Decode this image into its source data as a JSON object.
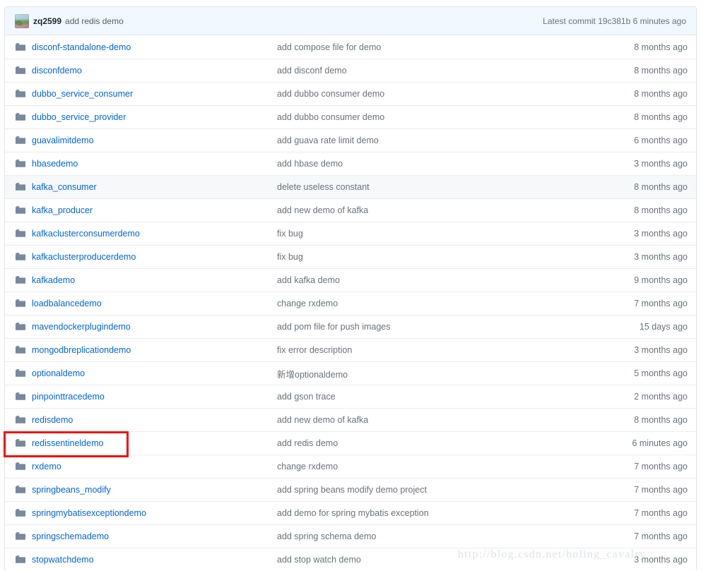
{
  "colors": {
    "link": "#0366d6",
    "muted": "#6a737d",
    "header_bg": "#f1f8ff",
    "border": "#dfe4e8",
    "row_border": "#eaecef",
    "row_hover": "#f6f8fa",
    "annotation": "#ee1111",
    "folder_icon": "#79889c"
  },
  "commit_header": {
    "avatar": "user-avatar",
    "author": "zq2599",
    "message": "add redis demo",
    "latest_commit_label": "Latest commit",
    "sha": "19c381b",
    "age": "6 minutes ago"
  },
  "files": [
    {
      "icon": "folder-icon",
      "name": "disconf-standalone-demo",
      "message": "add compose file for demo",
      "age": "8 months ago",
      "hovered": false,
      "highlighted": false
    },
    {
      "icon": "folder-icon",
      "name": "disconfdemo",
      "message": "add disconf demo",
      "age": "8 months ago",
      "hovered": false,
      "highlighted": false
    },
    {
      "icon": "folder-icon",
      "name": "dubbo_service_consumer",
      "message": "add dubbo consumer demo",
      "age": "8 months ago",
      "hovered": false,
      "highlighted": false
    },
    {
      "icon": "folder-icon",
      "name": "dubbo_service_provider",
      "message": "add dubbo consumer demo",
      "age": "8 months ago",
      "hovered": false,
      "highlighted": false
    },
    {
      "icon": "folder-icon",
      "name": "guavalimitdemo",
      "message": "add guava rate limit demo",
      "age": "6 months ago",
      "hovered": false,
      "highlighted": false
    },
    {
      "icon": "folder-icon",
      "name": "hbasedemo",
      "message": "add hbase demo",
      "age": "3 months ago",
      "hovered": false,
      "highlighted": false
    },
    {
      "icon": "folder-icon",
      "name": "kafka_consumer",
      "message": "delete useless constant",
      "age": "8 months ago",
      "hovered": true,
      "highlighted": false
    },
    {
      "icon": "folder-icon",
      "name": "kafka_producer",
      "message": "add new demo of kafka",
      "age": "8 months ago",
      "hovered": false,
      "highlighted": false
    },
    {
      "icon": "folder-icon",
      "name": "kafkaclusterconsumerdemo",
      "message": "fix bug",
      "age": "3 months ago",
      "hovered": false,
      "highlighted": false
    },
    {
      "icon": "folder-icon",
      "name": "kafkaclusterproducerdemo",
      "message": "fix bug",
      "age": "3 months ago",
      "hovered": false,
      "highlighted": false
    },
    {
      "icon": "folder-icon",
      "name": "kafkademo",
      "message": "add kafka demo",
      "age": "9 months ago",
      "hovered": false,
      "highlighted": false
    },
    {
      "icon": "folder-icon",
      "name": "loadbalancedemo",
      "message": "change rxdemo",
      "age": "7 months ago",
      "hovered": false,
      "highlighted": false
    },
    {
      "icon": "folder-icon",
      "name": "mavendockerplugindemo",
      "message": "add pom file for push images",
      "age": "15 days ago",
      "hovered": false,
      "highlighted": false
    },
    {
      "icon": "folder-icon",
      "name": "mongodbreplicationdemo",
      "message": "fix error description",
      "age": "3 months ago",
      "hovered": false,
      "highlighted": false
    },
    {
      "icon": "folder-icon",
      "name": "optionaldemo",
      "message": "新增optionaldemo",
      "age": "5 months ago",
      "hovered": false,
      "highlighted": false
    },
    {
      "icon": "folder-icon",
      "name": "pinpointtracedemo",
      "message": "add gson trace",
      "age": "2 months ago",
      "hovered": false,
      "highlighted": false
    },
    {
      "icon": "folder-icon",
      "name": "redisdemo",
      "message": "add new demo of kafka",
      "age": "8 months ago",
      "hovered": false,
      "highlighted": false
    },
    {
      "icon": "folder-icon",
      "name": "redissentineldemo",
      "message": "add redis demo",
      "age": "6 minutes ago",
      "hovered": false,
      "highlighted": true
    },
    {
      "icon": "folder-icon",
      "name": "rxdemo",
      "message": "change rxdemo",
      "age": "7 months ago",
      "hovered": false,
      "highlighted": false
    },
    {
      "icon": "folder-icon",
      "name": "springbeans_modify",
      "message": "add spring beans modify demo project",
      "age": "7 months ago",
      "hovered": false,
      "highlighted": false
    },
    {
      "icon": "folder-icon",
      "name": "springmybatisexceptiondemo",
      "message": "add demo for spring mybatis exception",
      "age": "7 months ago",
      "hovered": false,
      "highlighted": false
    },
    {
      "icon": "folder-icon",
      "name": "springschemademo",
      "message": "add spring schema demo",
      "age": "7 months ago",
      "hovered": false,
      "highlighted": false
    },
    {
      "icon": "folder-icon",
      "name": "stopwatchdemo",
      "message": "add stop watch demo",
      "age": "3 months ago",
      "hovered": false,
      "highlighted": false
    }
  ],
  "watermark": {
    "text": "http://blog.csdn.net/boling_cavalry"
  }
}
